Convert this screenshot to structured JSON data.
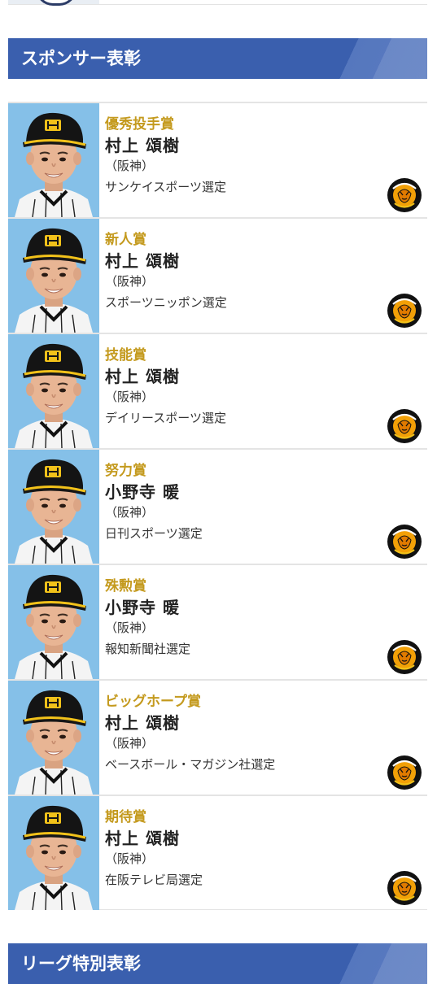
{
  "sections": {
    "sponsor_title": "スポンサー表彰",
    "league_title": "リーグ特別表彰"
  },
  "team_logo_icon": "hanshin-tigers-logo",
  "awards": [
    {
      "award": "優秀投手賞",
      "player": "村上 頌樹",
      "team": "（阪神）",
      "selection": "サンケイスポーツ選定"
    },
    {
      "award": "新人賞",
      "player": "村上 頌樹",
      "team": "（阪神）",
      "selection": "スポーツニッポン選定"
    },
    {
      "award": "技能賞",
      "player": "村上 頌樹",
      "team": "（阪神）",
      "selection": "デイリースポーツ選定"
    },
    {
      "award": "努力賞",
      "player": "小野寺 暖",
      "team": "（阪神）",
      "selection": "日刊スポーツ選定"
    },
    {
      "award": "殊勲賞",
      "player": "小野寺 暖",
      "team": "（阪神）",
      "selection": "報知新聞社選定"
    },
    {
      "award": "ビッグホープ賞",
      "player": "村上 頌樹",
      "team": "（阪神）",
      "selection": "ベースボール・マガジン社選定"
    },
    {
      "award": "期待賞",
      "player": "村上 頌樹",
      "team": "（阪神）",
      "selection": "在阪テレビ局選定"
    }
  ],
  "colors": {
    "banner": "#3a5fae",
    "award_text": "#c49a1e"
  }
}
